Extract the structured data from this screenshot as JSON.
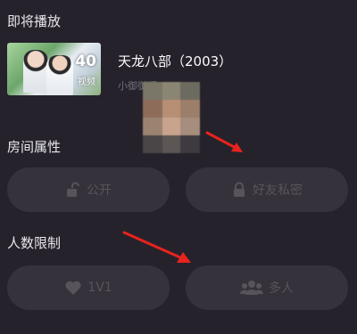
{
  "sections": {
    "upcoming": "即将播放",
    "room": "房间属性",
    "limit": "人数限制"
  },
  "media": {
    "title": "天龙八部（2003）",
    "thumb_count": "40",
    "thumb_sub": "视频",
    "subtitle": "小御御呀"
  },
  "room_options": {
    "public": "公开",
    "private": "好友私密"
  },
  "limit_options": {
    "one": "1V1",
    "multi": "多人"
  },
  "icons": {
    "public": "unlock-icon",
    "private": "lock-icon",
    "one": "heart-icon",
    "multi": "people-icon"
  },
  "colors": {
    "background": "#25222b",
    "button": "#35323b",
    "disabled_text": "#57545c",
    "arrow": "#e8231d"
  }
}
